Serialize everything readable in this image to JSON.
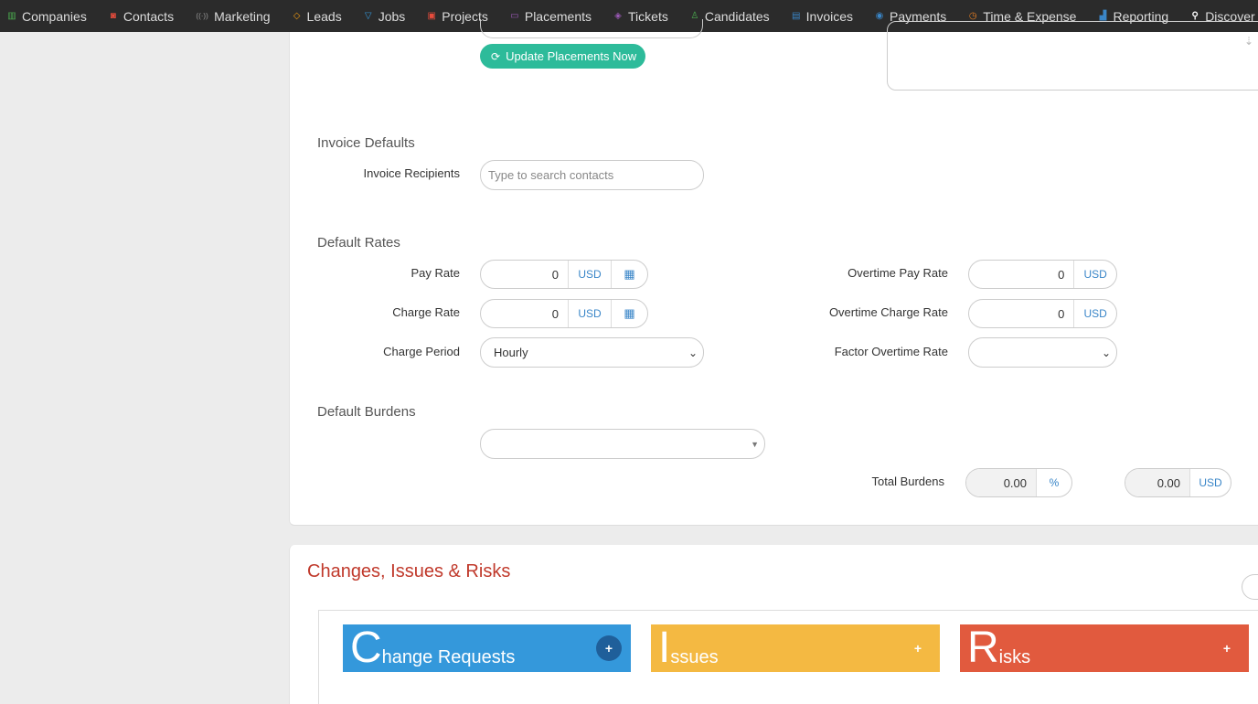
{
  "nav": {
    "items": [
      {
        "label": "Companies",
        "icon": "building-icon",
        "glyph": "▥",
        "color": "#4caf50"
      },
      {
        "label": "Contacts",
        "icon": "contacts-icon",
        "glyph": "◙",
        "color": "#e74c3c"
      },
      {
        "label": "Marketing",
        "icon": "broadcast-icon",
        "glyph": "((·))",
        "color": "#999999"
      },
      {
        "label": "Leads",
        "icon": "lead-icon",
        "glyph": "◇",
        "color": "#f39c12"
      },
      {
        "label": "Jobs",
        "icon": "jobs-icon",
        "glyph": "▽",
        "color": "#3498db"
      },
      {
        "label": "Projects",
        "icon": "projects-icon",
        "glyph": "▣",
        "color": "#e74c3c"
      },
      {
        "label": "Placements",
        "icon": "placements-icon",
        "glyph": "▭",
        "color": "#9b59b6"
      },
      {
        "label": "Tickets",
        "icon": "ticket-icon",
        "glyph": "◈",
        "color": "#9b59b6"
      },
      {
        "label": "Candidates",
        "icon": "candidate-icon",
        "glyph": "♙",
        "color": "#4caf50"
      },
      {
        "label": "Invoices",
        "icon": "invoice-icon",
        "glyph": "▤",
        "color": "#3a86c8"
      },
      {
        "label": "Payments",
        "icon": "payment-icon",
        "glyph": "◉",
        "color": "#3a86c8"
      },
      {
        "label": "Time & Expense",
        "icon": "clock-icon",
        "glyph": "◷",
        "color": "#e67e22"
      },
      {
        "label": "Reporting",
        "icon": "chart-icon",
        "glyph": "▟",
        "color": "#3a86c8"
      },
      {
        "label": "Discover",
        "icon": "search-icon",
        "glyph": "⚲",
        "color": "#ffffff"
      }
    ]
  },
  "top_section": {
    "update_button": "Update Placements Now",
    "notes_pin": "⇣"
  },
  "invoice_defaults": {
    "title": "Invoice Defaults",
    "recipients_label": "Invoice Recipients",
    "recipients_placeholder": "Type to search contacts"
  },
  "default_rates": {
    "title": "Default Rates",
    "pay_rate_label": "Pay Rate",
    "pay_rate_value": "0",
    "charge_rate_label": "Charge Rate",
    "charge_rate_value": "0",
    "currency": "USD",
    "charge_period_label": "Charge Period",
    "charge_period_value": "Hourly",
    "ot_pay_label": "Overtime Pay Rate",
    "ot_pay_value": "0",
    "ot_charge_label": "Overtime Charge Rate",
    "ot_charge_value": "0",
    "factor_ot_label": "Factor Overtime Rate",
    "factor_ot_value": ""
  },
  "default_burdens": {
    "title": "Default Burdens",
    "total_label": "Total Burdens",
    "total_percent": "0.00",
    "percent_sign": "%",
    "total_amount": "0.00",
    "currency": "USD"
  },
  "cir": {
    "title": "Changes, Issues & Risks",
    "cards": [
      {
        "initial": "C",
        "rest": "hange Requests",
        "color": "#3498db",
        "plus": "+"
      },
      {
        "initial": "I",
        "rest": "ssues",
        "color": "#f4b942",
        "plus": "+"
      },
      {
        "initial": "R",
        "rest": "isks",
        "color": "#e15a3e",
        "plus": "+"
      }
    ]
  }
}
